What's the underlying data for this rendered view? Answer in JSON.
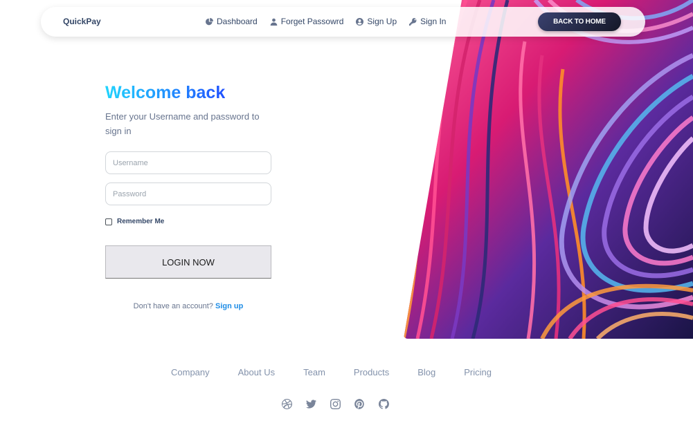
{
  "navbar": {
    "brand": "QuickPay",
    "links": [
      {
        "label": "Dashboard",
        "icon": "pie-chart-icon"
      },
      {
        "label": "Forget Passowrd",
        "icon": "user-icon"
      },
      {
        "label": "Sign Up",
        "icon": "user-circle-icon"
      },
      {
        "label": "Sign In",
        "icon": "key-icon"
      }
    ],
    "back_button": "BACK TO HOME"
  },
  "login": {
    "title": "Welcome back",
    "subtitle": "Enter your Username and password to sign in",
    "username_placeholder": "Username",
    "password_placeholder": "Password",
    "remember_label": "Remember Me",
    "login_button": "LOGIN NOW",
    "signup_prompt": "Don't have an account?",
    "signup_link": "Sign up"
  },
  "footer": {
    "links": [
      "Company",
      "About Us",
      "Team",
      "Products",
      "Blog",
      "Pricing"
    ],
    "socials": [
      "dribbble-icon",
      "twitter-icon",
      "instagram-icon",
      "pinterest-icon",
      "github-icon"
    ]
  },
  "colors": {
    "primary_dark": "#141727",
    "title_gradient_start": "#21d4fd",
    "title_gradient_end": "#2152ff",
    "link_blue": "#1f8de6"
  }
}
